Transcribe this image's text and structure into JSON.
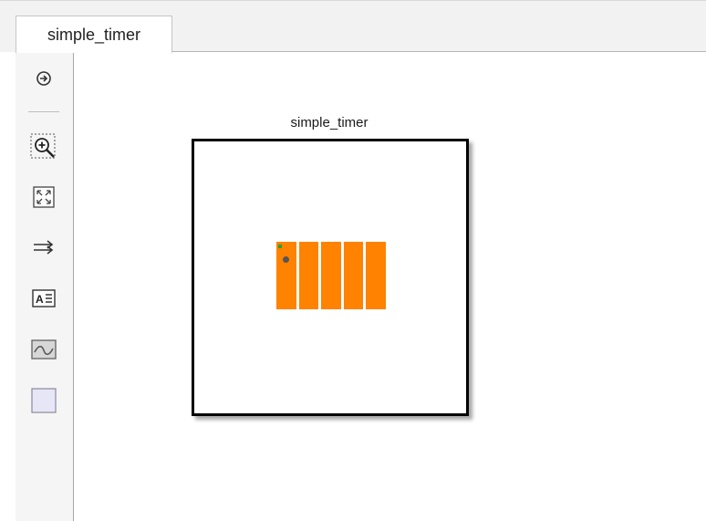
{
  "tab": {
    "label": "simple_timer"
  },
  "toolbar": {
    "items": [
      {
        "icon": "hide-show-browser-icon"
      },
      {
        "icon": "zoom-in-icon"
      },
      {
        "icon": "fit-to-view-icon"
      },
      {
        "icon": "signal-routing-icon"
      },
      {
        "icon": "annotation-icon"
      },
      {
        "icon": "image-icon"
      },
      {
        "icon": "area-icon"
      }
    ]
  },
  "canvas": {
    "subsystem": {
      "name": "simple_timer",
      "colors": {
        "border": "#000000",
        "fill": "#ffffff",
        "inner_block": "#ff8200"
      }
    }
  }
}
